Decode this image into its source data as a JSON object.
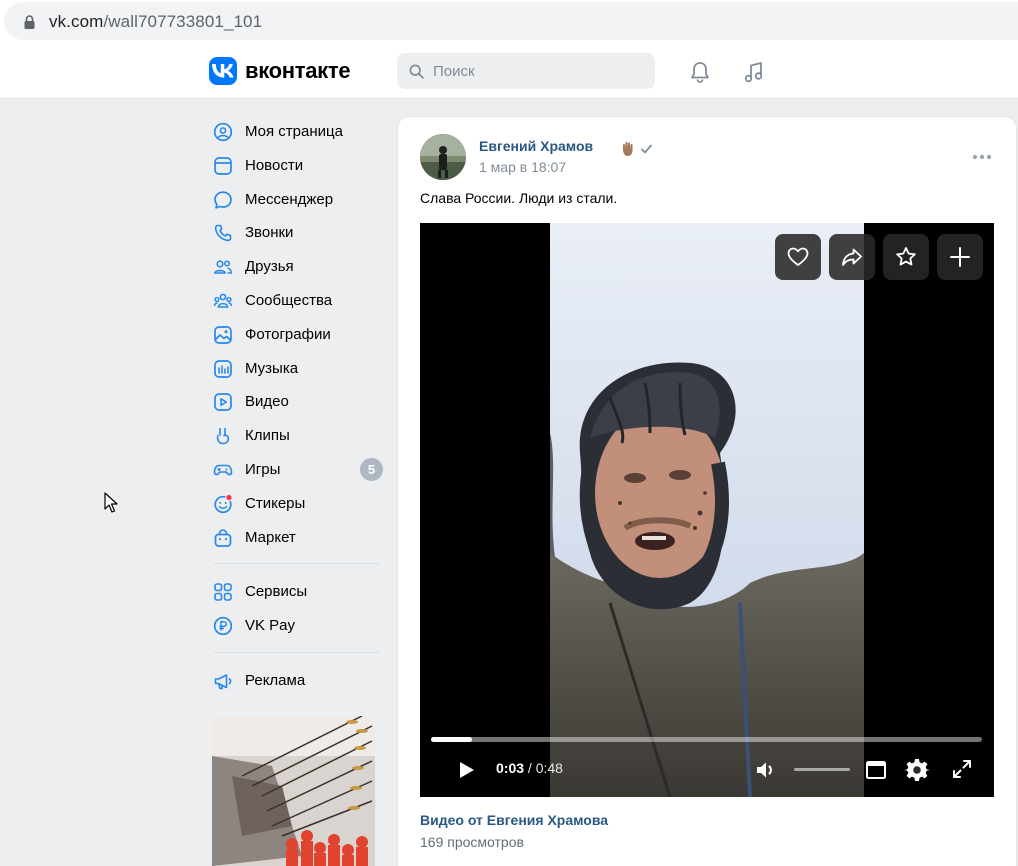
{
  "browser": {
    "url_domain": "vk.com",
    "url_path": "/wall707733801_101"
  },
  "header": {
    "logo_text": "вконтакте",
    "search_placeholder": "Поиск",
    "brand_color": "#0077ff"
  },
  "sidebar": {
    "items": [
      {
        "label": "Моя страница",
        "icon": "user-circle-icon"
      },
      {
        "label": "Новости",
        "icon": "news-icon"
      },
      {
        "label": "Мессенджер",
        "icon": "message-icon"
      },
      {
        "label": "Звонки",
        "icon": "phone-icon"
      },
      {
        "label": "Друзья",
        "icon": "friends-icon"
      },
      {
        "label": "Сообщества",
        "icon": "communities-icon"
      },
      {
        "label": "Фотографии",
        "icon": "photo-icon"
      },
      {
        "label": "Музыка",
        "icon": "music-icon"
      },
      {
        "label": "Видео",
        "icon": "video-icon"
      },
      {
        "label": "Клипы",
        "icon": "clips-icon"
      },
      {
        "label": "Игры",
        "icon": "games-icon",
        "badge": "5"
      },
      {
        "label": "Стикеры",
        "icon": "stickers-icon"
      },
      {
        "label": "Маркет",
        "icon": "market-icon"
      }
    ],
    "extra": [
      {
        "label": "Сервисы",
        "icon": "services-icon"
      },
      {
        "label": "VK Pay",
        "icon": "vkpay-icon"
      }
    ],
    "ads": {
      "label": "Реклама",
      "icon": "megaphone-icon"
    }
  },
  "post": {
    "author": "Евгений Храмов",
    "datetime": "1 мар в 18:07",
    "text": "Слава России. Люди из стали.",
    "video": {
      "current_time": "0:03",
      "separator": " / ",
      "duration": "0:48",
      "progress_fraction": 0.075,
      "title": "Видео от Евгения Храмова",
      "views": "169 просмотров"
    }
  }
}
